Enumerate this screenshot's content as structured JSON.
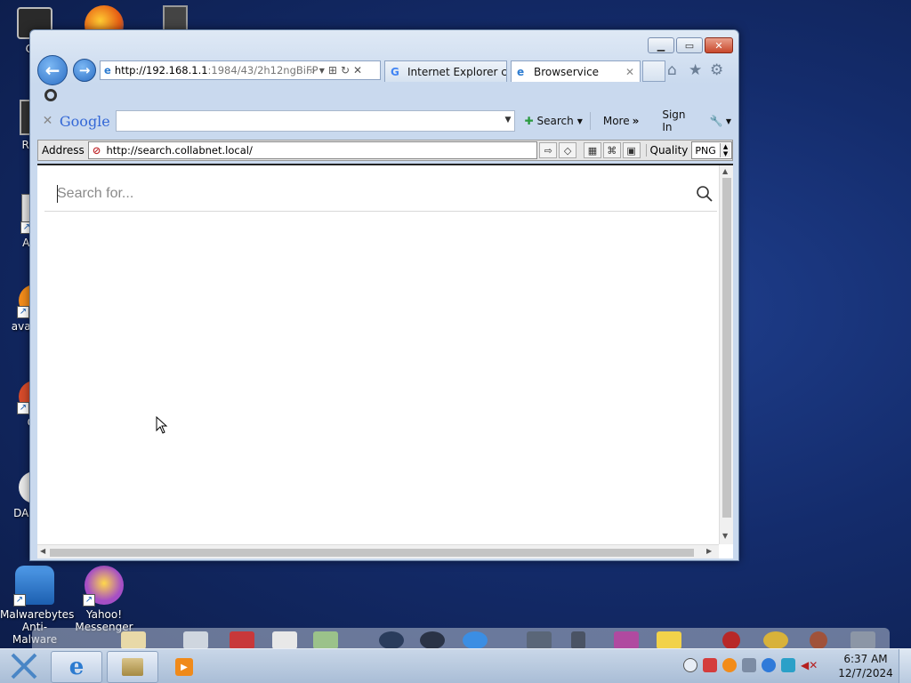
{
  "desktop": {
    "icons": [
      {
        "label": "Cor"
      },
      {
        "label": "Recy"
      },
      {
        "label": "Auto"
      },
      {
        "label": "avas Ant"
      },
      {
        "label": "CC"
      },
      {
        "label": "DAE Toc"
      },
      {
        "label": "Malwarebytes Anti-Malware"
      },
      {
        "label": "Yahoo! Messenger"
      }
    ]
  },
  "browser": {
    "address_url_host": "http://192.168.1.1",
    "address_url_rest": ":1984/43/2h12ngBiFP",
    "tabs": [
      {
        "label": "Internet Explorer ca..."
      },
      {
        "label": "Browservice"
      }
    ],
    "google_toolbar": {
      "logo": "Google",
      "search_label": "Search",
      "more_label": "More",
      "signin_label": "Sign In"
    },
    "address_bar": {
      "label": "Address",
      "url": "http://search.collabnet.local/",
      "quality_label": "Quality",
      "quality_value": "PNG"
    },
    "page": {
      "search_placeholder": "Search for..."
    }
  },
  "taskbar": {
    "time": "6:37 AM",
    "date": "12/7/2024"
  }
}
